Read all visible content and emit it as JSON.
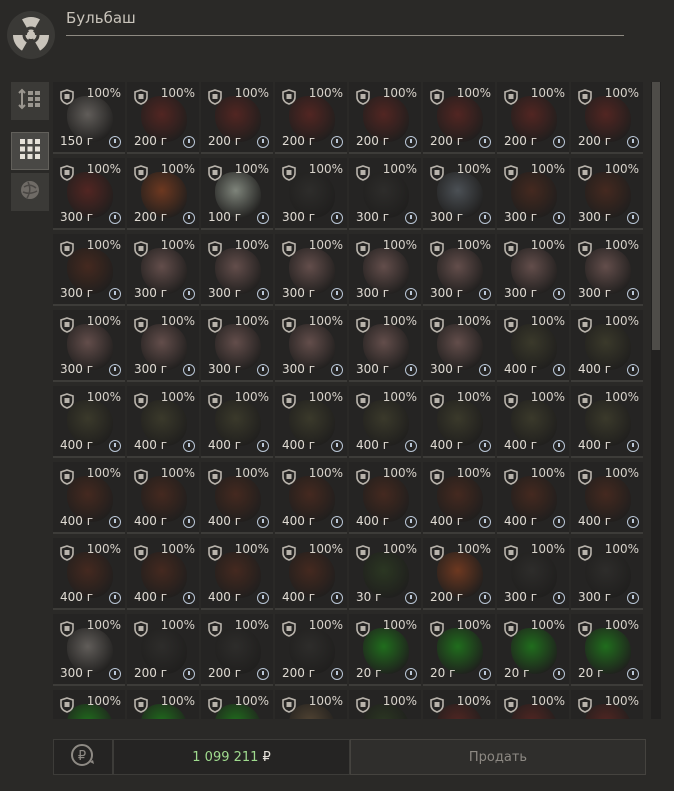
{
  "header": {
    "title": "Бульбаш"
  },
  "footer": {
    "money_value": "1 099 211",
    "currency": "₽",
    "sell_label": "Продать"
  },
  "item_colors": {
    "grey": "#6b6763",
    "red": "#5a2622",
    "orange": "#7a3c20",
    "pale": "#8e958a",
    "dark": "#2f2e2c",
    "blue": "#52585e",
    "brown": "#4a2a1f",
    "pink": "#6e5552",
    "olive": "#3e3d2c",
    "mossgreen": "#2c3a22",
    "green": "#1f7a1c",
    "bronze": "#5a4a36"
  },
  "items": [
    {
      "pct": "100%",
      "weight": "150 г",
      "color": "grey"
    },
    {
      "pct": "100%",
      "weight": "200 г",
      "color": "red"
    },
    {
      "pct": "100%",
      "weight": "200 г",
      "color": "red"
    },
    {
      "pct": "100%",
      "weight": "200 г",
      "color": "red"
    },
    {
      "pct": "100%",
      "weight": "200 г",
      "color": "red"
    },
    {
      "pct": "100%",
      "weight": "200 г",
      "color": "red"
    },
    {
      "pct": "100%",
      "weight": "200 г",
      "color": "red"
    },
    {
      "pct": "100%",
      "weight": "200 г",
      "color": "red"
    },
    {
      "pct": "100%",
      "weight": "300 г",
      "color": "red"
    },
    {
      "pct": "100%",
      "weight": "200 г",
      "color": "orange"
    },
    {
      "pct": "100%",
      "weight": "100 г",
      "color": "pale"
    },
    {
      "pct": "100%",
      "weight": "300 г",
      "color": "dark"
    },
    {
      "pct": "100%",
      "weight": "300 г",
      "color": "dark"
    },
    {
      "pct": "100%",
      "weight": "300 г",
      "color": "blue"
    },
    {
      "pct": "100%",
      "weight": "300 г",
      "color": "brown"
    },
    {
      "pct": "100%",
      "weight": "300 г",
      "color": "brown"
    },
    {
      "pct": "100%",
      "weight": "300 г",
      "color": "brown"
    },
    {
      "pct": "100%",
      "weight": "300 г",
      "color": "pink"
    },
    {
      "pct": "100%",
      "weight": "300 г",
      "color": "pink"
    },
    {
      "pct": "100%",
      "weight": "300 г",
      "color": "pink"
    },
    {
      "pct": "100%",
      "weight": "300 г",
      "color": "pink"
    },
    {
      "pct": "100%",
      "weight": "300 г",
      "color": "pink"
    },
    {
      "pct": "100%",
      "weight": "300 г",
      "color": "pink"
    },
    {
      "pct": "100%",
      "weight": "300 г",
      "color": "pink"
    },
    {
      "pct": "100%",
      "weight": "300 г",
      "color": "pink"
    },
    {
      "pct": "100%",
      "weight": "300 г",
      "color": "pink"
    },
    {
      "pct": "100%",
      "weight": "300 г",
      "color": "pink"
    },
    {
      "pct": "100%",
      "weight": "300 г",
      "color": "pink"
    },
    {
      "pct": "100%",
      "weight": "300 г",
      "color": "pink"
    },
    {
      "pct": "100%",
      "weight": "300 г",
      "color": "pink"
    },
    {
      "pct": "100%",
      "weight": "400 г",
      "color": "olive"
    },
    {
      "pct": "100%",
      "weight": "400 г",
      "color": "olive"
    },
    {
      "pct": "100%",
      "weight": "400 г",
      "color": "olive"
    },
    {
      "pct": "100%",
      "weight": "400 г",
      "color": "olive"
    },
    {
      "pct": "100%",
      "weight": "400 г",
      "color": "olive"
    },
    {
      "pct": "100%",
      "weight": "400 г",
      "color": "olive"
    },
    {
      "pct": "100%",
      "weight": "400 г",
      "color": "olive"
    },
    {
      "pct": "100%",
      "weight": "400 г",
      "color": "olive"
    },
    {
      "pct": "100%",
      "weight": "400 г",
      "color": "olive"
    },
    {
      "pct": "100%",
      "weight": "400 г",
      "color": "olive"
    },
    {
      "pct": "100%",
      "weight": "400 г",
      "color": "brown"
    },
    {
      "pct": "100%",
      "weight": "400 г",
      "color": "brown"
    },
    {
      "pct": "100%",
      "weight": "400 г",
      "color": "brown"
    },
    {
      "pct": "100%",
      "weight": "400 г",
      "color": "brown"
    },
    {
      "pct": "100%",
      "weight": "400 г",
      "color": "brown"
    },
    {
      "pct": "100%",
      "weight": "400 г",
      "color": "brown"
    },
    {
      "pct": "100%",
      "weight": "400 г",
      "color": "brown"
    },
    {
      "pct": "100%",
      "weight": "400 г",
      "color": "brown"
    },
    {
      "pct": "100%",
      "weight": "400 г",
      "color": "brown"
    },
    {
      "pct": "100%",
      "weight": "400 г",
      "color": "brown"
    },
    {
      "pct": "100%",
      "weight": "400 г",
      "color": "brown"
    },
    {
      "pct": "100%",
      "weight": "400 г",
      "color": "brown"
    },
    {
      "pct": "100%",
      "weight": "30 г",
      "color": "mossgreen"
    },
    {
      "pct": "100%",
      "weight": "200 г",
      "color": "orange"
    },
    {
      "pct": "100%",
      "weight": "300 г",
      "color": "dark"
    },
    {
      "pct": "100%",
      "weight": "300 г",
      "color": "dark"
    },
    {
      "pct": "100%",
      "weight": "300 г",
      "color": "grey"
    },
    {
      "pct": "100%",
      "weight": "200 г",
      "color": "dark"
    },
    {
      "pct": "100%",
      "weight": "200 г",
      "color": "dark"
    },
    {
      "pct": "100%",
      "weight": "200 г",
      "color": "dark"
    },
    {
      "pct": "100%",
      "weight": "20 г",
      "color": "green"
    },
    {
      "pct": "100%",
      "weight": "20 г",
      "color": "green"
    },
    {
      "pct": "100%",
      "weight": "20 г",
      "color": "green"
    },
    {
      "pct": "100%",
      "weight": "20 г",
      "color": "green"
    },
    {
      "pct": "100%",
      "weight": "",
      "color": "green"
    },
    {
      "pct": "100%",
      "weight": "",
      "color": "green"
    },
    {
      "pct": "100%",
      "weight": "",
      "color": "green"
    },
    {
      "pct": "100%",
      "weight": "",
      "color": "bronze"
    },
    {
      "pct": "100%",
      "weight": "",
      "color": "mossgreen"
    },
    {
      "pct": "100%",
      "weight": "",
      "color": "red"
    },
    {
      "pct": "100%",
      "weight": "",
      "color": "red"
    },
    {
      "pct": "100%",
      "weight": "",
      "color": "red"
    }
  ]
}
